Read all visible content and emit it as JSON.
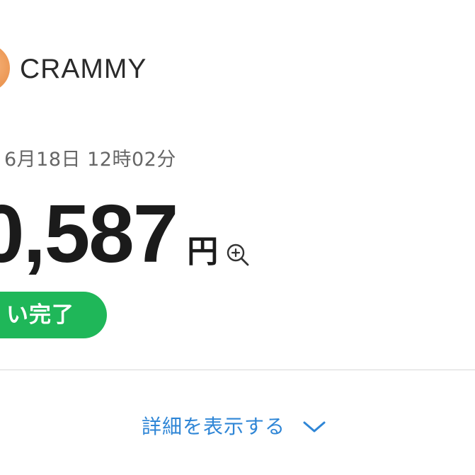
{
  "merchant": {
    "name": "CRAMMY",
    "avatar_color": "#e9904a"
  },
  "transaction": {
    "timestamp": "6月18日 12時02分",
    "amount": "0,587",
    "currency_symbol": "円",
    "status": "い完了",
    "status_color": "#1fb759"
  },
  "details": {
    "toggle_label": "詳細を表示する",
    "accent_color": "#2f86d6"
  },
  "icons": {
    "zoom": "zoom-in-icon",
    "expand": "chevron-down-icon"
  }
}
